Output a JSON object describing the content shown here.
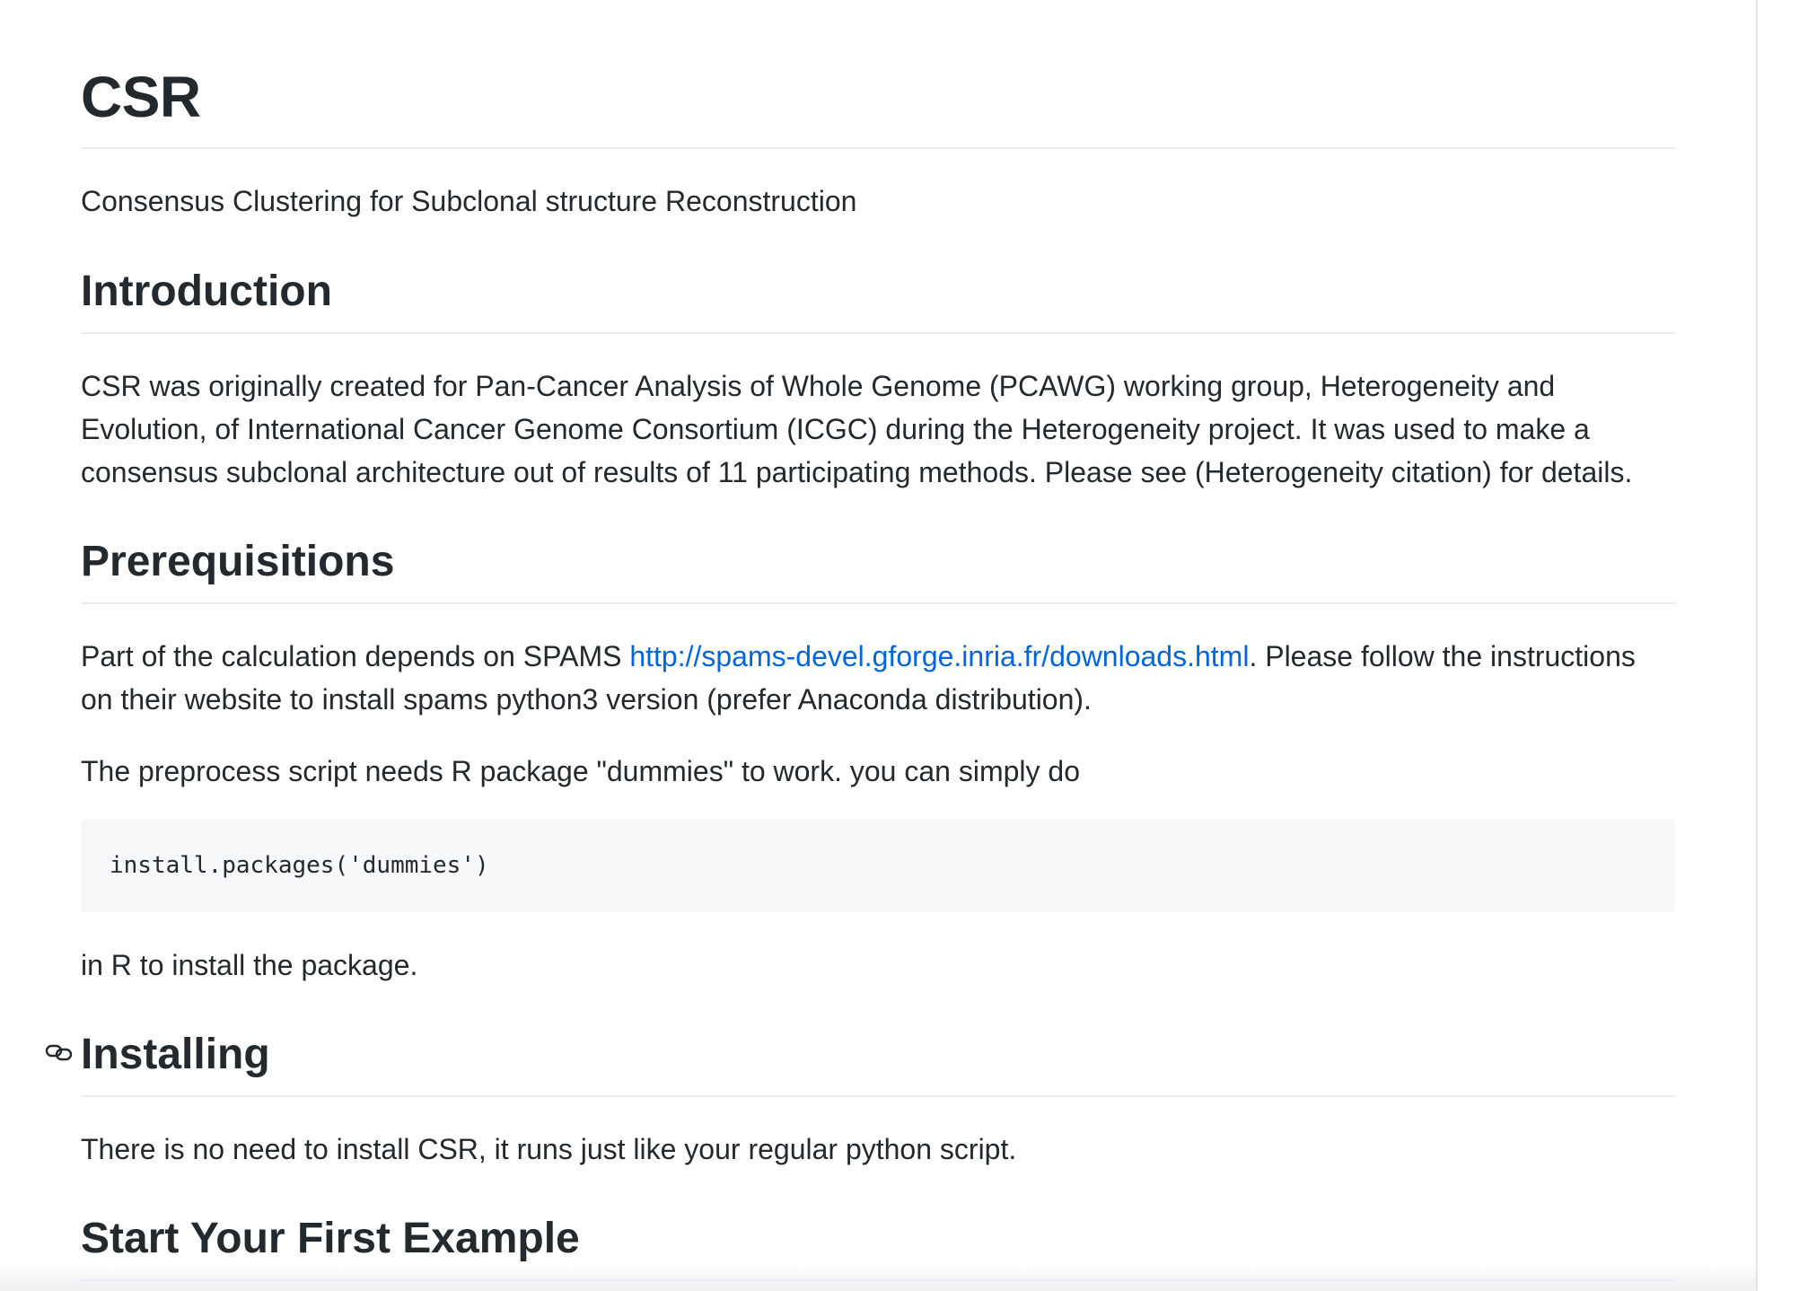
{
  "readme": {
    "title": "CSR",
    "subtitle": "Consensus Clustering for Subclonal structure Reconstruction",
    "sections": {
      "introduction": {
        "heading": "Introduction",
        "body": "CSR was originally created for Pan-Cancer Analysis of Whole Genome (PCAWG) working group, Heterogeneity and Evolution, of International Cancer Genome Consortium (ICGC) during the Heterogeneity project. It was used to make a consensus subclonal architecture out of results of 11 participating methods. Please see (Heterogeneity citation) for details."
      },
      "prerequisitions": {
        "heading": "Prerequisitions",
        "p1_before_link": "Part of the calculation depends on SPAMS ",
        "p1_link": "http://spams-devel.gforge.inria.fr/downloads.html",
        "p1_after_link": ". Please follow the instructions on their website to install spams python3 version (prefer Anaconda distribution).",
        "p2": "The preprocess script needs R package \"dummies\" to work. you can simply do",
        "code": "install.packages('dummies')",
        "p3": "in R to install the package."
      },
      "installing": {
        "heading": "Installing",
        "body": "There is no need to install CSR, it runs just like your regular python script."
      },
      "first_example": {
        "heading": "Start Your First Example"
      }
    }
  },
  "icons": {
    "heading_anchor": "link-icon"
  },
  "colors": {
    "text": "#24292e",
    "link": "#0366d6",
    "rule": "#eaecef",
    "code_background": "#f6f8fa"
  }
}
